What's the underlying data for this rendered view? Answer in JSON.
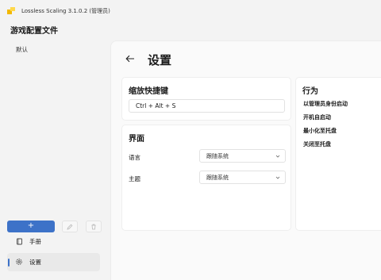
{
  "window": {
    "title": "Lossless Scaling 3.1.0.2 (管理员)"
  },
  "sidebar": {
    "title": "游戏配置文件",
    "profiles": [
      "默认"
    ],
    "add_label": "+",
    "nav": [
      {
        "label": "手册",
        "icon": "book-icon"
      },
      {
        "label": "设置",
        "icon": "gear-icon"
      }
    ]
  },
  "page": {
    "title": "设置"
  },
  "hotkey": {
    "title": "缩放快捷键",
    "value": "Ctrl + Alt + S"
  },
  "interface": {
    "title": "界面",
    "language": {
      "label": "语言",
      "value": "跟随系统"
    },
    "theme": {
      "label": "主题",
      "value": "跟随系统"
    }
  },
  "behavior": {
    "title": "行为",
    "items": [
      "以管理员身份启动",
      "开机自启动",
      "最小化至托盘",
      "关闭至托盘"
    ]
  },
  "colors": {
    "accent": "#3d72c8",
    "background": "#f3f3f3",
    "card": "#ffffff"
  }
}
